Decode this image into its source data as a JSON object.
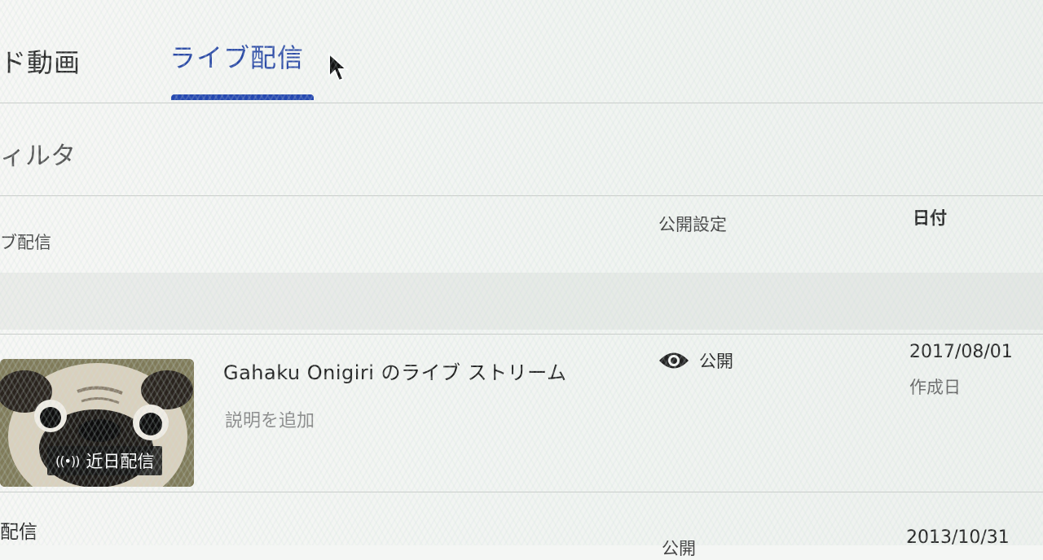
{
  "tabs": {
    "previous_partial": "ド動画",
    "active": "ライブ配信"
  },
  "filter": {
    "label_partial": "ィルタ"
  },
  "table": {
    "headers": {
      "title_partial": "ブ配信",
      "visibility": "公開設定",
      "date": "日付"
    }
  },
  "rows": [
    {
      "title": "Gahaku Onigiri のライブ ストリーム",
      "description": "説明を追加",
      "badge": "近日配信",
      "badge_icon": "broadcast-icon",
      "visibility": "公開",
      "visibility_icon": "eye-icon",
      "date": "2017/08/01",
      "date_sub": "作成日"
    },
    {
      "title_partial": "配信",
      "visibility_partial": "公開",
      "date": "2013/10/31"
    }
  ],
  "colors": {
    "accent": "#2548b0",
    "active_tab_text": "#2b4aa6",
    "divider": "#c9ccc9"
  }
}
